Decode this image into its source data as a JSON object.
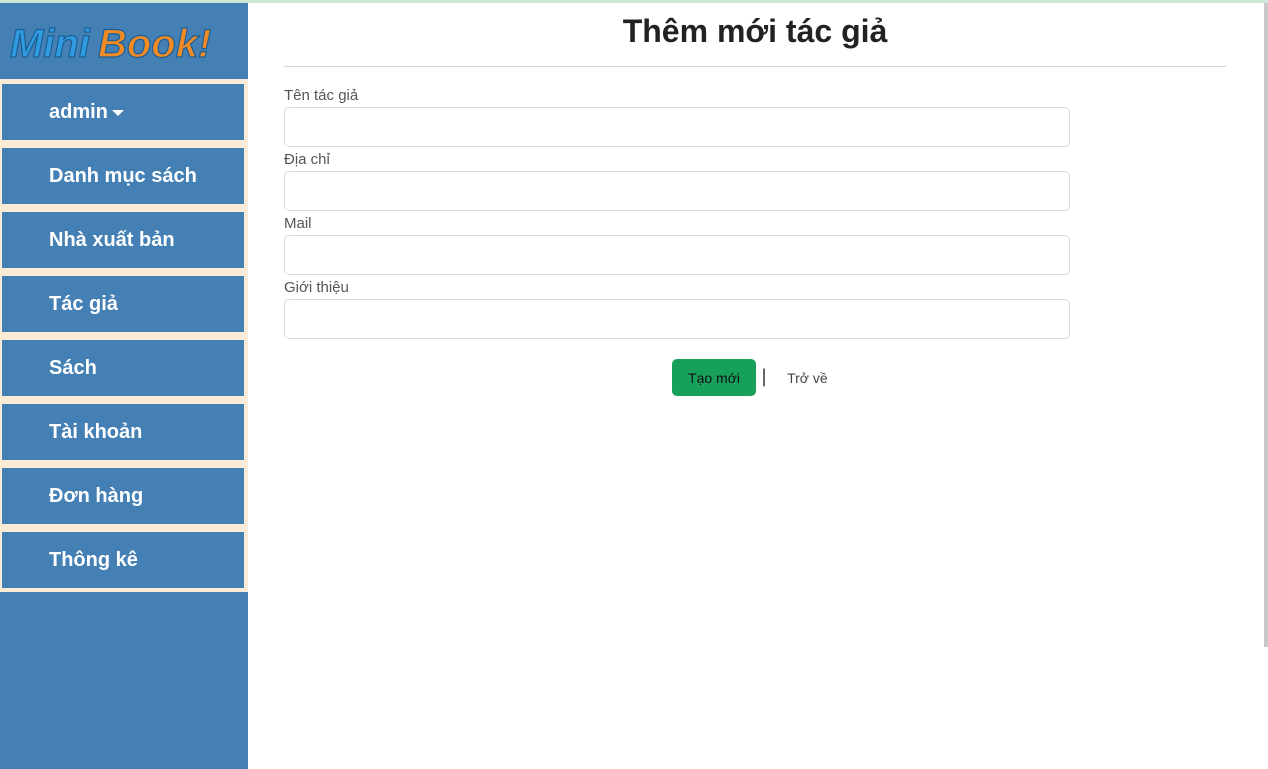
{
  "logo": {
    "text": "Mini Book!"
  },
  "sidebar": {
    "items": [
      {
        "label": "admin",
        "has_dropdown": true
      },
      {
        "label": "Danh mục sách"
      },
      {
        "label": "Nhà xuất bản"
      },
      {
        "label": "Tác giả"
      },
      {
        "label": "Sách"
      },
      {
        "label": "Tài khoản"
      },
      {
        "label": "Đơn hàng"
      },
      {
        "label": "Thông kê"
      }
    ]
  },
  "page": {
    "title": "Thêm mới tác giả"
  },
  "form": {
    "fields": [
      {
        "label": "Tên tác giả",
        "value": ""
      },
      {
        "label": "Địa chỉ",
        "value": ""
      },
      {
        "label": "Mail",
        "value": ""
      },
      {
        "label": "Giới thiệu",
        "value": ""
      }
    ],
    "create_label": "Tạo mới",
    "separator": "|",
    "back_label": "Trở về"
  },
  "colors": {
    "sidebar_bg": "#4580b5",
    "menu_gap": "#f8ecd7",
    "create_button": "#16a05a",
    "logo_main": "#2f9be0",
    "logo_accent": "#f08a24"
  }
}
